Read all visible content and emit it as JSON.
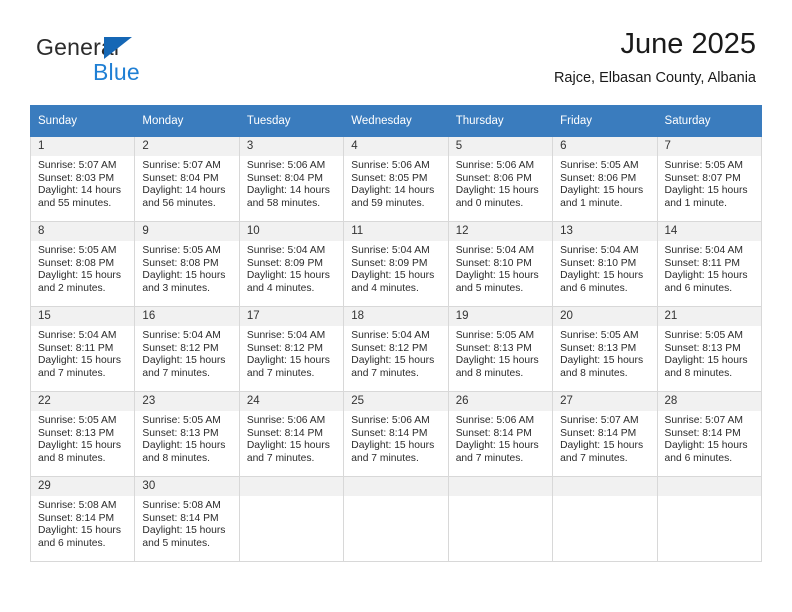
{
  "brand": {
    "name_top": "General",
    "name_bottom": "Blue",
    "accent_color": "#1f7fd4",
    "triangle_color": "#1567b5"
  },
  "header": {
    "title": "June 2025",
    "subtitle": "Rajce, Elbasan County, Albania"
  },
  "calendar": {
    "header_bg": "#3a7cbe",
    "daynum_bg": "#f1f1f1",
    "weekdays": [
      "Sunday",
      "Monday",
      "Tuesday",
      "Wednesday",
      "Thursday",
      "Friday",
      "Saturday"
    ],
    "weeks": [
      [
        {
          "day": "1",
          "sunrise": "Sunrise: 5:07 AM",
          "sunset": "Sunset: 8:03 PM",
          "daylight": "Daylight: 14 hours and 55 minutes."
        },
        {
          "day": "2",
          "sunrise": "Sunrise: 5:07 AM",
          "sunset": "Sunset: 8:04 PM",
          "daylight": "Daylight: 14 hours and 56 minutes."
        },
        {
          "day": "3",
          "sunrise": "Sunrise: 5:06 AM",
          "sunset": "Sunset: 8:04 PM",
          "daylight": "Daylight: 14 hours and 58 minutes."
        },
        {
          "day": "4",
          "sunrise": "Sunrise: 5:06 AM",
          "sunset": "Sunset: 8:05 PM",
          "daylight": "Daylight: 14 hours and 59 minutes."
        },
        {
          "day": "5",
          "sunrise": "Sunrise: 5:06 AM",
          "sunset": "Sunset: 8:06 PM",
          "daylight": "Daylight: 15 hours and 0 minutes."
        },
        {
          "day": "6",
          "sunrise": "Sunrise: 5:05 AM",
          "sunset": "Sunset: 8:06 PM",
          "daylight": "Daylight: 15 hours and 1 minute."
        },
        {
          "day": "7",
          "sunrise": "Sunrise: 5:05 AM",
          "sunset": "Sunset: 8:07 PM",
          "daylight": "Daylight: 15 hours and 1 minute."
        }
      ],
      [
        {
          "day": "8",
          "sunrise": "Sunrise: 5:05 AM",
          "sunset": "Sunset: 8:08 PM",
          "daylight": "Daylight: 15 hours and 2 minutes."
        },
        {
          "day": "9",
          "sunrise": "Sunrise: 5:05 AM",
          "sunset": "Sunset: 8:08 PM",
          "daylight": "Daylight: 15 hours and 3 minutes."
        },
        {
          "day": "10",
          "sunrise": "Sunrise: 5:04 AM",
          "sunset": "Sunset: 8:09 PM",
          "daylight": "Daylight: 15 hours and 4 minutes."
        },
        {
          "day": "11",
          "sunrise": "Sunrise: 5:04 AM",
          "sunset": "Sunset: 8:09 PM",
          "daylight": "Daylight: 15 hours and 4 minutes."
        },
        {
          "day": "12",
          "sunrise": "Sunrise: 5:04 AM",
          "sunset": "Sunset: 8:10 PM",
          "daylight": "Daylight: 15 hours and 5 minutes."
        },
        {
          "day": "13",
          "sunrise": "Sunrise: 5:04 AM",
          "sunset": "Sunset: 8:10 PM",
          "daylight": "Daylight: 15 hours and 6 minutes."
        },
        {
          "day": "14",
          "sunrise": "Sunrise: 5:04 AM",
          "sunset": "Sunset: 8:11 PM",
          "daylight": "Daylight: 15 hours and 6 minutes."
        }
      ],
      [
        {
          "day": "15",
          "sunrise": "Sunrise: 5:04 AM",
          "sunset": "Sunset: 8:11 PM",
          "daylight": "Daylight: 15 hours and 7 minutes."
        },
        {
          "day": "16",
          "sunrise": "Sunrise: 5:04 AM",
          "sunset": "Sunset: 8:12 PM",
          "daylight": "Daylight: 15 hours and 7 minutes."
        },
        {
          "day": "17",
          "sunrise": "Sunrise: 5:04 AM",
          "sunset": "Sunset: 8:12 PM",
          "daylight": "Daylight: 15 hours and 7 minutes."
        },
        {
          "day": "18",
          "sunrise": "Sunrise: 5:04 AM",
          "sunset": "Sunset: 8:12 PM",
          "daylight": "Daylight: 15 hours and 7 minutes."
        },
        {
          "day": "19",
          "sunrise": "Sunrise: 5:05 AM",
          "sunset": "Sunset: 8:13 PM",
          "daylight": "Daylight: 15 hours and 8 minutes."
        },
        {
          "day": "20",
          "sunrise": "Sunrise: 5:05 AM",
          "sunset": "Sunset: 8:13 PM",
          "daylight": "Daylight: 15 hours and 8 minutes."
        },
        {
          "day": "21",
          "sunrise": "Sunrise: 5:05 AM",
          "sunset": "Sunset: 8:13 PM",
          "daylight": "Daylight: 15 hours and 8 minutes."
        }
      ],
      [
        {
          "day": "22",
          "sunrise": "Sunrise: 5:05 AM",
          "sunset": "Sunset: 8:13 PM",
          "daylight": "Daylight: 15 hours and 8 minutes."
        },
        {
          "day": "23",
          "sunrise": "Sunrise: 5:05 AM",
          "sunset": "Sunset: 8:13 PM",
          "daylight": "Daylight: 15 hours and 8 minutes."
        },
        {
          "day": "24",
          "sunrise": "Sunrise: 5:06 AM",
          "sunset": "Sunset: 8:14 PM",
          "daylight": "Daylight: 15 hours and 7 minutes."
        },
        {
          "day": "25",
          "sunrise": "Sunrise: 5:06 AM",
          "sunset": "Sunset: 8:14 PM",
          "daylight": "Daylight: 15 hours and 7 minutes."
        },
        {
          "day": "26",
          "sunrise": "Sunrise: 5:06 AM",
          "sunset": "Sunset: 8:14 PM",
          "daylight": "Daylight: 15 hours and 7 minutes."
        },
        {
          "day": "27",
          "sunrise": "Sunrise: 5:07 AM",
          "sunset": "Sunset: 8:14 PM",
          "daylight": "Daylight: 15 hours and 7 minutes."
        },
        {
          "day": "28",
          "sunrise": "Sunrise: 5:07 AM",
          "sunset": "Sunset: 8:14 PM",
          "daylight": "Daylight: 15 hours and 6 minutes."
        }
      ],
      [
        {
          "day": "29",
          "sunrise": "Sunrise: 5:08 AM",
          "sunset": "Sunset: 8:14 PM",
          "daylight": "Daylight: 15 hours and 6 minutes."
        },
        {
          "day": "30",
          "sunrise": "Sunrise: 5:08 AM",
          "sunset": "Sunset: 8:14 PM",
          "daylight": "Daylight: 15 hours and 5 minutes."
        },
        null,
        null,
        null,
        null,
        null
      ]
    ]
  }
}
